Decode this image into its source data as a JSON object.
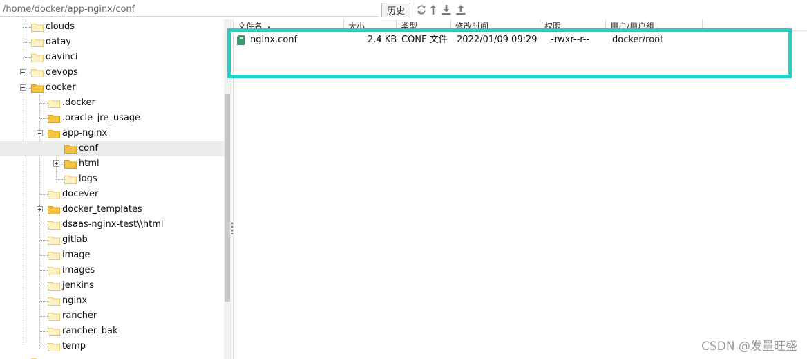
{
  "toolbar": {
    "path_value": "/home/docker/app-nginx/conf",
    "history_label": "历史",
    "icons": [
      "refresh-icon",
      "up-dir-icon",
      "download-icon",
      "upload-icon"
    ]
  },
  "tree": {
    "items": [
      {
        "label": "clouds"
      },
      {
        "label": "datay"
      },
      {
        "label": "davinci"
      },
      {
        "label": "devops"
      },
      {
        "label": "docker"
      },
      {
        "label": ".docker"
      },
      {
        "label": ".oracle_jre_usage"
      },
      {
        "label": "app-nginx"
      },
      {
        "label": "conf"
      },
      {
        "label": "html"
      },
      {
        "label": "logs"
      },
      {
        "label": "docever"
      },
      {
        "label": "docker_templates"
      },
      {
        "label": "dsaas-nginx-test\\\\html"
      },
      {
        "label": "gitlab"
      },
      {
        "label": "image"
      },
      {
        "label": "images"
      },
      {
        "label": "jenkins"
      },
      {
        "label": "nginx"
      },
      {
        "label": "rancher"
      },
      {
        "label": "rancher_bak"
      },
      {
        "label": "temp"
      }
    ]
  },
  "file_list": {
    "columns": [
      "文件名",
      "大小",
      "类型",
      "修改时间",
      "权限",
      "用户/用户组"
    ],
    "rows": [
      {
        "name": "nginx.conf",
        "size": "2.4 KB",
        "type": "CONF 文件",
        "modified": "2022/01/09 09:29",
        "permissions": "-rwxr--r--",
        "owner": "docker/root"
      }
    ]
  },
  "watermark": "CSDN @发量旺盛",
  "colors": {
    "highlight": "#1ed2c9",
    "folder": "#f5c342",
    "selected_row": "#ececec"
  }
}
